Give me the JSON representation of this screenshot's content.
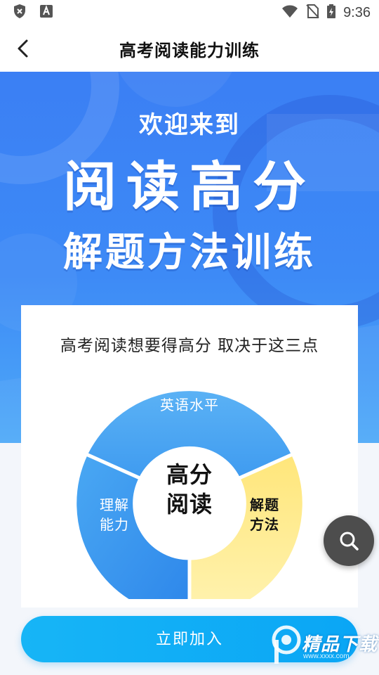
{
  "status_bar": {
    "time": "9:36",
    "icons": [
      "shield-x-icon",
      "font-a-icon",
      "wifi-icon",
      "no-sim-icon",
      "battery-charging-icon"
    ]
  },
  "header": {
    "title": "高考阅读能力训练",
    "back_icon": "chevron-left-icon"
  },
  "banner": {
    "welcome": "欢迎来到",
    "title": "阅读高分",
    "subtitle": "解题方法训练",
    "bg_color": "#3b7ff4"
  },
  "card": {
    "title": "高考阅读想要得高分 取决于这三点",
    "center": {
      "line1": "高分",
      "line2": "阅读"
    },
    "segments": [
      {
        "line1": "英语水平",
        "line2": "",
        "color": "#4aa4f2"
      },
      {
        "line1": "解题",
        "line2": "方法",
        "color": "#ffe46a"
      },
      {
        "line1": "理解",
        "line2": "能力",
        "color": "#3b95f0"
      }
    ]
  },
  "cta": {
    "label": "立即加入",
    "color": "#10aef6"
  },
  "fab": {
    "icon": "search-icon"
  },
  "watermark": {
    "text": "精品下载",
    "sub": "www.xxxx.com",
    "logo": "p-logo-icon"
  }
}
